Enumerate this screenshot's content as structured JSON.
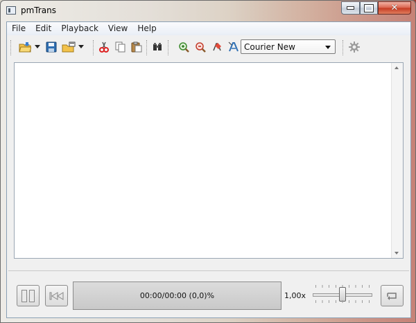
{
  "window": {
    "title": "pmTrans"
  },
  "menu": [
    "File",
    "Edit",
    "Playback",
    "View",
    "Help"
  ],
  "toolbar": {
    "font_selected": "Courier New",
    "icons": [
      "open-folder-icon",
      "save-disk-icon",
      "export-icon",
      "cut-icon",
      "copy-icon",
      "paste-icon",
      "find-icon",
      "zoom-in-icon",
      "zoom-out-icon",
      "font-color-icon",
      "font-style-icon",
      "settings-gear-icon"
    ]
  },
  "player": {
    "time_display": "00:00/00:00 (0,0)%",
    "speed_label": "1,00x",
    "speed_value": 1.0,
    "speed_range": [
      0.5,
      1.5
    ]
  },
  "colors": {
    "accent": "#2f6fb3",
    "close": "#c43a22"
  }
}
